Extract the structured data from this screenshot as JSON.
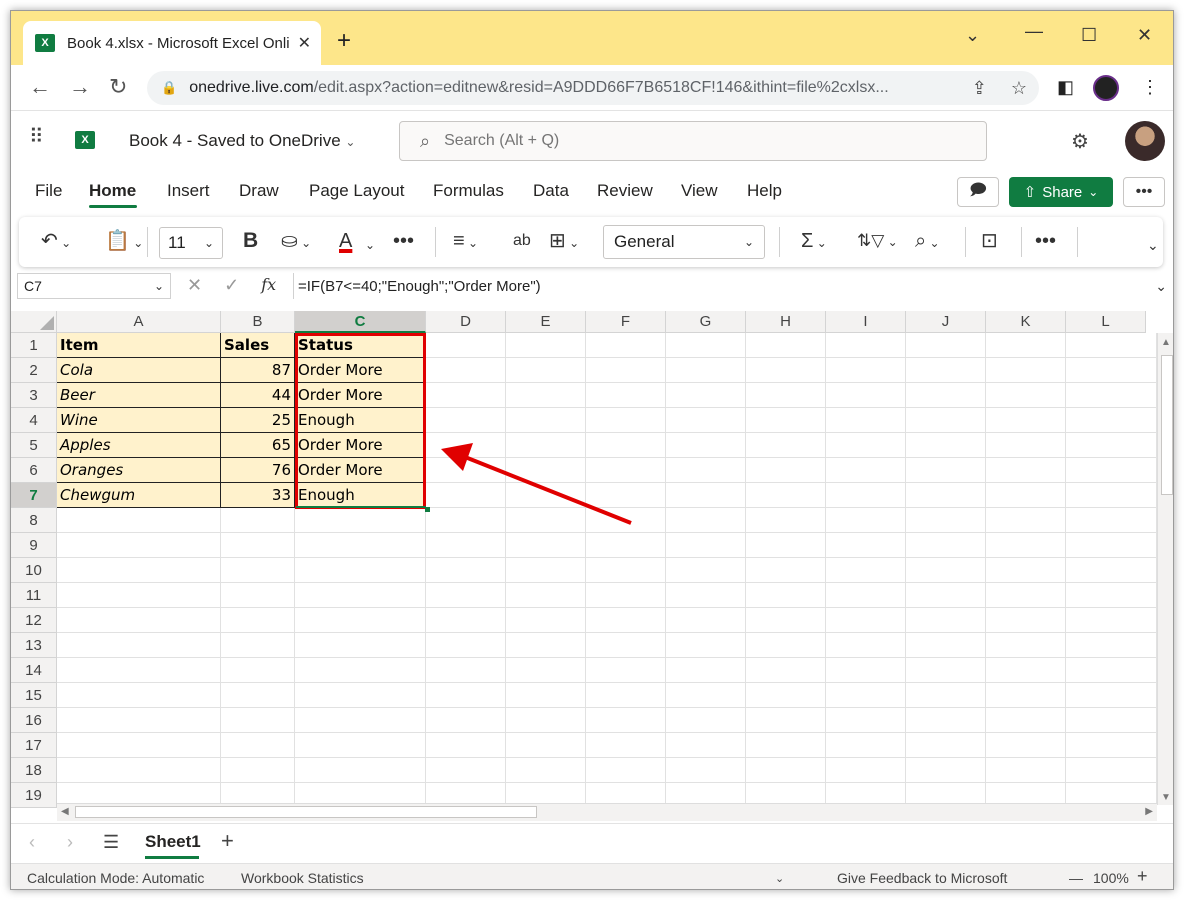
{
  "browser": {
    "tab_title": "Book 4.xlsx - Microsoft Excel Onli",
    "tab_close": "✕",
    "new_tab": "+",
    "url_domain": "onedrive.live.com",
    "url_path": "/edit.aspx?action=editnew&resid=A9DDD66F7B6518CF!146&ithint=file%2cxlsx..."
  },
  "app": {
    "logo_text": "X",
    "title": "Book 4  -  Saved to OneDrive",
    "search_placeholder": "Search (Alt + Q)"
  },
  "menu": {
    "items": [
      "File",
      "Home",
      "Insert",
      "Draw",
      "Page Layout",
      "Formulas",
      "Data",
      "Review",
      "View",
      "Help"
    ],
    "active": "Home",
    "share_label": "Share"
  },
  "ribbon": {
    "font_size": "11",
    "number_format": "General"
  },
  "formula_bar": {
    "name_box": "C7",
    "fx_label": "fx",
    "formula": "=IF(B7<=40;\"Enough\";\"Order More\")"
  },
  "sheet": {
    "columns": [
      "A",
      "B",
      "C",
      "D",
      "E",
      "F",
      "G",
      "H",
      "I",
      "J",
      "K",
      "L"
    ],
    "selected_column": "C",
    "row_numbers": [
      "1",
      "2",
      "3",
      "4",
      "5",
      "6",
      "7",
      "8",
      "9",
      "10",
      "11",
      "12",
      "13",
      "14",
      "15",
      "16",
      "17",
      "18",
      "19"
    ],
    "selected_row": "7",
    "headers": [
      "Item",
      "Sales",
      "Status"
    ],
    "rows": [
      {
        "item": "Cola",
        "sales": "87",
        "status": "Order More"
      },
      {
        "item": "Beer",
        "sales": "44",
        "status": "Order More"
      },
      {
        "item": "Wine",
        "sales": "25",
        "status": "Enough"
      },
      {
        "item": "Apples",
        "sales": "65",
        "status": "Order More"
      },
      {
        "item": "Oranges",
        "sales": "76",
        "status": "Order More"
      },
      {
        "item": "Chewgum",
        "sales": "33",
        "status": "Enough"
      }
    ],
    "table_fill_color": "#fff2cc",
    "highlight_color": "#e00000"
  },
  "tabs": {
    "sheet_name": "Sheet1",
    "add": "+"
  },
  "status": {
    "calc_mode": "Calculation Mode: Automatic",
    "workbook_stats": "Workbook Statistics",
    "feedback": "Give Feedback to Microsoft",
    "zoom": "100%",
    "zoom_minus": "—",
    "zoom_plus": "+"
  }
}
